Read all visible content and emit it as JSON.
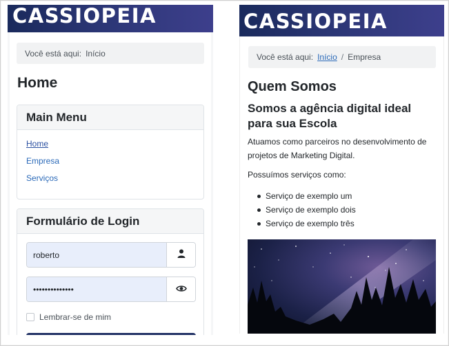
{
  "site": {
    "name": "CASSIOPEIA"
  },
  "left_page": {
    "breadcrumb": {
      "prefix": "Você está aqui:",
      "current": "Início"
    },
    "title": "Home",
    "main_menu": {
      "title": "Main Menu",
      "items": [
        {
          "label": "Home"
        },
        {
          "label": "Empresa"
        },
        {
          "label": "Serviços"
        }
      ]
    },
    "login": {
      "title": "Formulário de Login",
      "username_value": "roberto",
      "password_value": "••••••••••••••",
      "remember_label": "Lembrar-se de mim",
      "user_icon": "user-icon",
      "reveal_icon": "eye-icon"
    }
  },
  "right_page": {
    "breadcrumb": {
      "prefix": "Você está aqui:",
      "link": "Início",
      "separator": "/",
      "current": "Empresa"
    },
    "heading": "Quem Somos",
    "subheading": "Somos a agência digital ideal para sua Escola",
    "paragraph1": "Atuamos como parceiros no desenvolvimento de projetos de Marketing Digital.",
    "paragraph2": "Possuímos serviços como:",
    "services": [
      "Serviço de exemplo um",
      "Serviço de exemplo dois",
      "Serviço de exemplo três"
    ]
  },
  "colors": {
    "header": "#2b3675",
    "link": "#2a69b8",
    "input_bg": "#e8eefb",
    "login_button": "#1f2f63"
  }
}
